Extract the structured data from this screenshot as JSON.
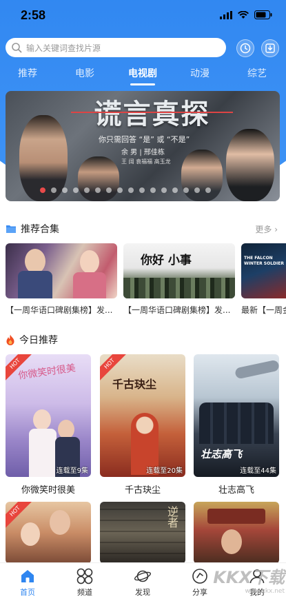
{
  "status": {
    "time": "2:58"
  },
  "search": {
    "placeholder": "输入关键词查找片源"
  },
  "nav_tabs": [
    {
      "label": "推荐"
    },
    {
      "label": "电影"
    },
    {
      "label": "电视剧"
    },
    {
      "label": "动漫"
    },
    {
      "label": "综艺"
    }
  ],
  "banner": {
    "title": "谎言真探",
    "subtitle": "你只需回答 “是” 或 “不是”",
    "cast_line": "余 男  |  邢佳栋",
    "cast_line2": "王 阔    袁福福    高玉龙",
    "slide_count": 16,
    "active_slide": 0
  },
  "collections": {
    "title": "推荐合集",
    "more": "更多 ›",
    "items": [
      {
        "caption": "【一周华语口碑剧集榜】发...",
        "art_text": ""
      },
      {
        "caption": "【一周华语口碑剧集榜】发...",
        "art_text": "你好 小事"
      },
      {
        "caption": "最新【一周金",
        "art_text": "THE FALCON WINTER SOLDIER"
      }
    ]
  },
  "today": {
    "title": "今日推荐",
    "hot_label": "HOT",
    "items": [
      {
        "name": "你微笑时很美",
        "badge": "连载至9集",
        "art": "你微笑时很美",
        "hot": true
      },
      {
        "name": "千古玦尘",
        "badge": "连载至20集",
        "art": "千古玦尘",
        "hot": true
      },
      {
        "name": "壮志高飞",
        "badge": "连载至44集",
        "art": "壮志高飞",
        "hot": true
      },
      {
        "name": "",
        "badge": "",
        "art": "",
        "hot": true
      },
      {
        "name": "",
        "badge": "",
        "art": "逆者",
        "hot": false
      },
      {
        "name": "",
        "badge": "",
        "art": "",
        "hot": false
      }
    ]
  },
  "bottom_nav": [
    {
      "label": "首页",
      "icon": "home-icon",
      "active": true
    },
    {
      "label": "频道",
      "icon": "channel-grid-icon",
      "active": false
    },
    {
      "label": "发现",
      "icon": "planet-icon",
      "active": false
    },
    {
      "label": "分享",
      "icon": "share-icon",
      "active": false
    },
    {
      "label": "我的",
      "icon": "profile-icon",
      "active": false
    }
  ],
  "watermark": {
    "brand": "KKX下载",
    "url": "www.kkx.net"
  },
  "colors": {
    "accent": "#2f86f0",
    "hot": "#e8453c",
    "fire": "#f04e23"
  }
}
